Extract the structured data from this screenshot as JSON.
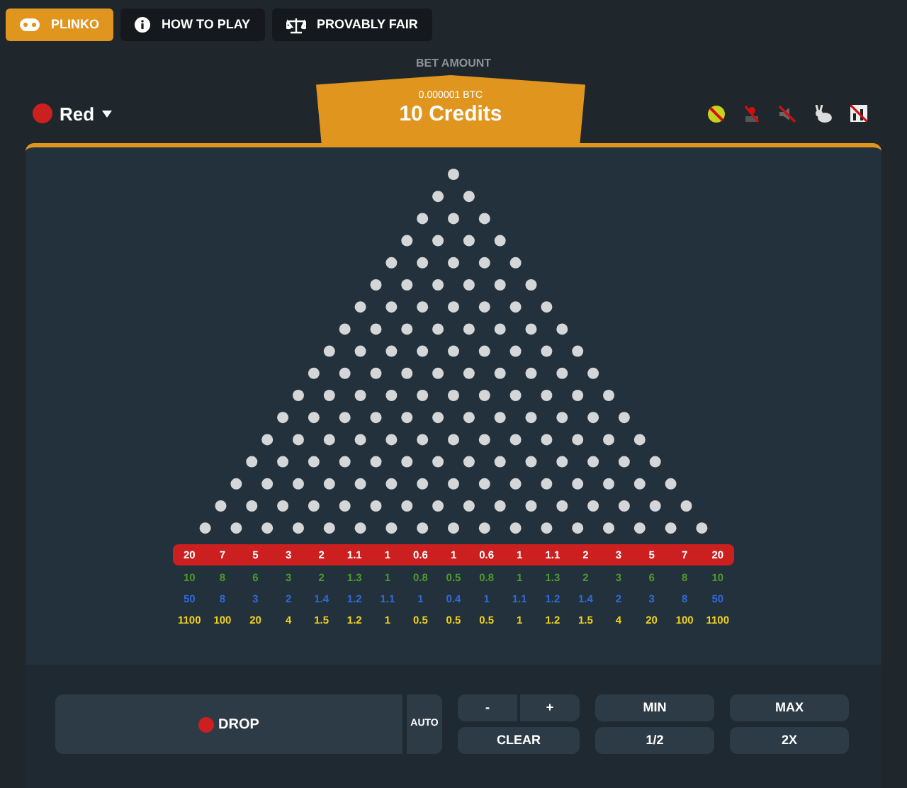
{
  "tabs": [
    {
      "label": "PLINKO",
      "selected": true
    },
    {
      "label": "HOW TO PLAY",
      "selected": false
    },
    {
      "label": "PROVABLY FAIR",
      "selected": false
    }
  ],
  "risk": {
    "label": "Red",
    "color": "#cc1f1f"
  },
  "bet": {
    "label": "BET AMOUNT",
    "btc": "0.000001 BTC",
    "credits": "10 Credits"
  },
  "multipliers": [
    {
      "color": "#cc1f1f",
      "kind": "bar",
      "values": [
        "20",
        "7",
        "5",
        "3",
        "2",
        "1.1",
        "1",
        "0.6",
        "1",
        "0.6",
        "1",
        "1.1",
        "2",
        "3",
        "5",
        "7",
        "20"
      ]
    },
    {
      "color": "#4e9a2b",
      "kind": "text",
      "values": [
        "10",
        "8",
        "6",
        "3",
        "2",
        "1.3",
        "1",
        "0.8",
        "0.5",
        "0.8",
        "1",
        "1.3",
        "2",
        "3",
        "6",
        "8",
        "10"
      ]
    },
    {
      "color": "#2f6ad8",
      "kind": "text",
      "values": [
        "50",
        "8",
        "3",
        "2",
        "1.4",
        "1.2",
        "1.1",
        "1",
        "0.4",
        "1",
        "1.1",
        "1.2",
        "1.4",
        "2",
        "3",
        "8",
        "50"
      ]
    },
    {
      "color": "#f0d01c",
      "kind": "text",
      "values": [
        "1100",
        "100",
        "20",
        "4",
        "1.5",
        "1.2",
        "1",
        "0.5",
        "0.5",
        "0.5",
        "1",
        "1.2",
        "1.5",
        "4",
        "20",
        "100",
        "1100"
      ]
    }
  ],
  "drop": {
    "label": "DROP",
    "color": "#cc1f1f"
  },
  "auto": {
    "label": "AUTO"
  },
  "bet_buttons": [
    [
      "-",
      "+",
      "MIN",
      "MAX"
    ],
    [
      "CLEAR",
      "1/2",
      "2X"
    ]
  ]
}
